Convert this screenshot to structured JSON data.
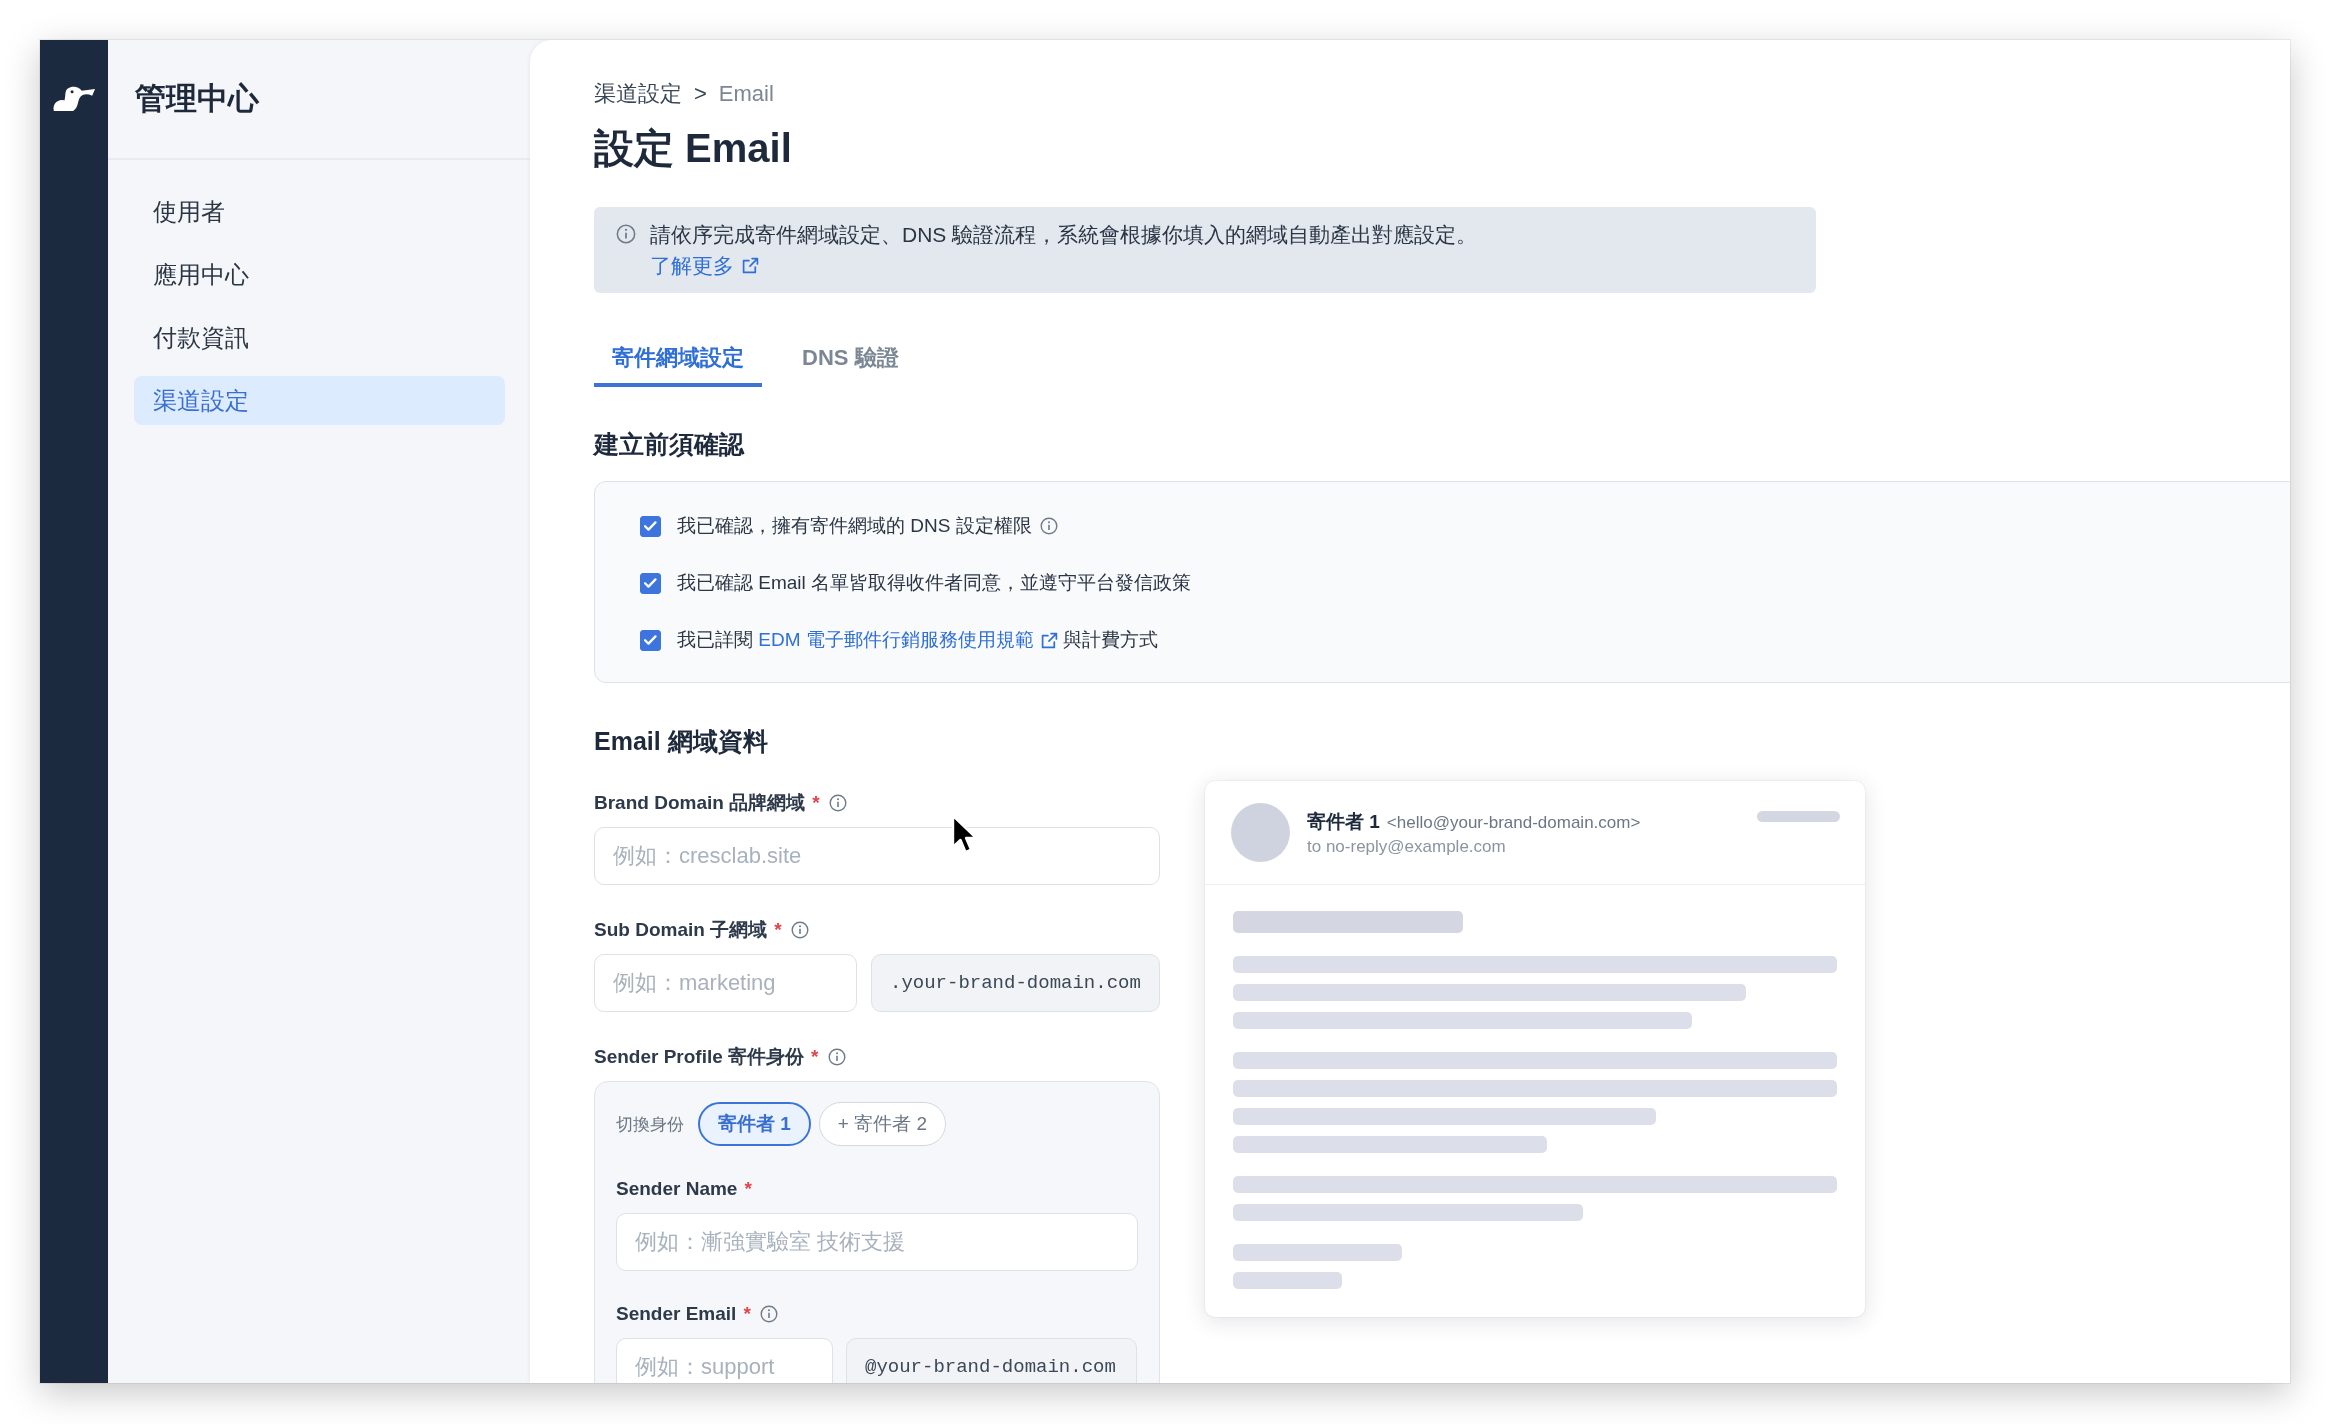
{
  "sidebar": {
    "title": "管理中心",
    "items": [
      {
        "label": "使用者",
        "selected": false
      },
      {
        "label": "應用中心",
        "selected": false
      },
      {
        "label": "付款資訊",
        "selected": false
      },
      {
        "label": "渠道設定",
        "selected": true
      }
    ]
  },
  "breadcrumb": {
    "items": [
      "渠道設定",
      "Email"
    ],
    "separator": ">"
  },
  "page_title": "設定 Email",
  "info_banner": {
    "text": "請依序完成寄件網域設定、DNS 驗證流程，系統會根據你填入的網域自動產出對應設定。",
    "link": "了解更多"
  },
  "tabs": [
    {
      "label": "寄件網域設定",
      "selected": true
    },
    {
      "label": "DNS 驗證",
      "selected": false
    }
  ],
  "prerequisites": {
    "heading": "建立前須確認",
    "items": [
      {
        "text": "我已確認，擁有寄件網域的 DNS 設定權限",
        "checked": true,
        "info_icon": true
      },
      {
        "text": "我已確認 Email 名單皆取得收件者同意，並遵守平台發信政策",
        "checked": true
      },
      {
        "text": "我已詳閱",
        "link": "EDM 電子郵件行銷服務使用規範",
        "text_after": "與計費方式",
        "checked": true
      }
    ]
  },
  "domain_form": {
    "heading": "Email 網域資料",
    "brand_domain": {
      "label": "Brand Domain 品牌網域",
      "required_mark": "*",
      "info_icon": true,
      "placeholder": "例如：cresclab.site"
    },
    "sub_domain": {
      "label": "Sub Domain 子網域",
      "required_mark": "*",
      "info_icon": true,
      "placeholder": "例如：marketing",
      "suffix": ".your-brand-domain.com"
    },
    "sender_profile": {
      "label": "Sender Profile 寄件身份",
      "required_mark": "*",
      "info_icon": true,
      "switch_label": "切換身份",
      "senders": [
        {
          "label": "寄件者 1",
          "selected": true
        },
        {
          "label": "+ 寄件者 2",
          "selected": false
        }
      ],
      "sender_name": {
        "label": "Sender Name",
        "required_mark": "*",
        "placeholder": "例如：漸強實驗室 技術支援"
      },
      "sender_email": {
        "label": "Sender Email",
        "required_mark": "*",
        "info_icon": true,
        "placeholder": "例如：support",
        "suffix": "@your-brand-domain.com"
      }
    }
  },
  "email_preview": {
    "sender_name": "寄件者 1",
    "sender_address": "<hello@your-brand-domain.com>",
    "recipient": "to no-reply@example.com"
  }
}
